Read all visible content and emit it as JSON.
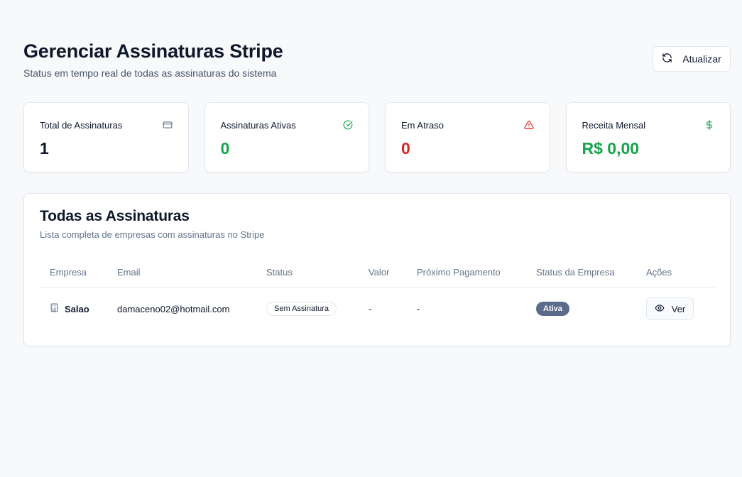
{
  "header": {
    "title": "Gerenciar Assinaturas Stripe",
    "subtitle": "Status em tempo real de todas as assinaturas do sistema",
    "refresh_label": "Atualizar"
  },
  "stats": [
    {
      "label": "Total de Assinaturas",
      "value": "1",
      "icon": "credit-card-icon",
      "color": "#0f172a"
    },
    {
      "label": "Assinaturas Ativas",
      "value": "0",
      "icon": "check-circle-icon",
      "color": "#16a34a"
    },
    {
      "label": "Em Atraso",
      "value": "0",
      "icon": "alert-triangle-icon",
      "color": "#dc2626"
    },
    {
      "label": "Receita Mensal",
      "value": "R$ 0,00",
      "icon": "dollar-icon",
      "color": "#16a34a"
    }
  ],
  "table_card": {
    "title": "Todas as Assinaturas",
    "subtitle": "Lista completa de empresas com assinaturas no Stripe",
    "columns": [
      "Empresa",
      "Email",
      "Status",
      "Valor",
      "Próximo Pagamento",
      "Status da Empresa",
      "Ações"
    ],
    "rows": [
      {
        "company": "Salao",
        "email": "damaceno02@hotmail.com",
        "status": "Sem Assinatura",
        "value": "-",
        "next_payment": "-",
        "company_status": "Ativa",
        "action_label": "Ver"
      }
    ]
  }
}
